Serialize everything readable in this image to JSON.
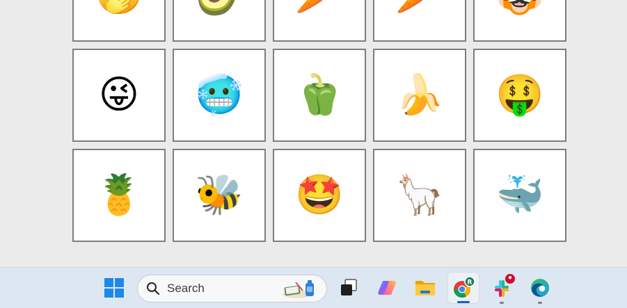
{
  "grid": {
    "tiles": [
      {
        "emoji": "🤭",
        "name": "hand-over-mouth"
      },
      {
        "emoji": "🥑",
        "name": "avocado"
      },
      {
        "emoji": "🥕",
        "name": "carrot"
      },
      {
        "emoji": "🥕",
        "name": "carrot"
      },
      {
        "emoji": "🐯",
        "name": "tiger-face"
      },
      {
        "emoji": "😜",
        "name": "winking-tongue"
      },
      {
        "emoji": "🥶",
        "name": "cold-face"
      },
      {
        "emoji": "🫑",
        "name": "bell-pepper"
      },
      {
        "emoji": "🍌",
        "name": "banana"
      },
      {
        "emoji": "🤑",
        "name": "money-mouth"
      },
      {
        "emoji": "🍍",
        "name": "pineapple"
      },
      {
        "emoji": "🐝",
        "name": "bee"
      },
      {
        "emoji": "🤩",
        "name": "star-struck"
      },
      {
        "emoji": "🦙",
        "name": "llama"
      },
      {
        "emoji": "🐳",
        "name": "spouting-whale"
      }
    ]
  },
  "taskbar": {
    "search": {
      "label": "Search"
    },
    "icons": [
      "start-icon",
      "task-view-icon",
      "copilot-icon",
      "file-explorer-icon",
      "chrome-icon",
      "slack-icon",
      "edge-icon"
    ],
    "chrome_profile_initial": "R",
    "accent": "#1b5fb8"
  }
}
